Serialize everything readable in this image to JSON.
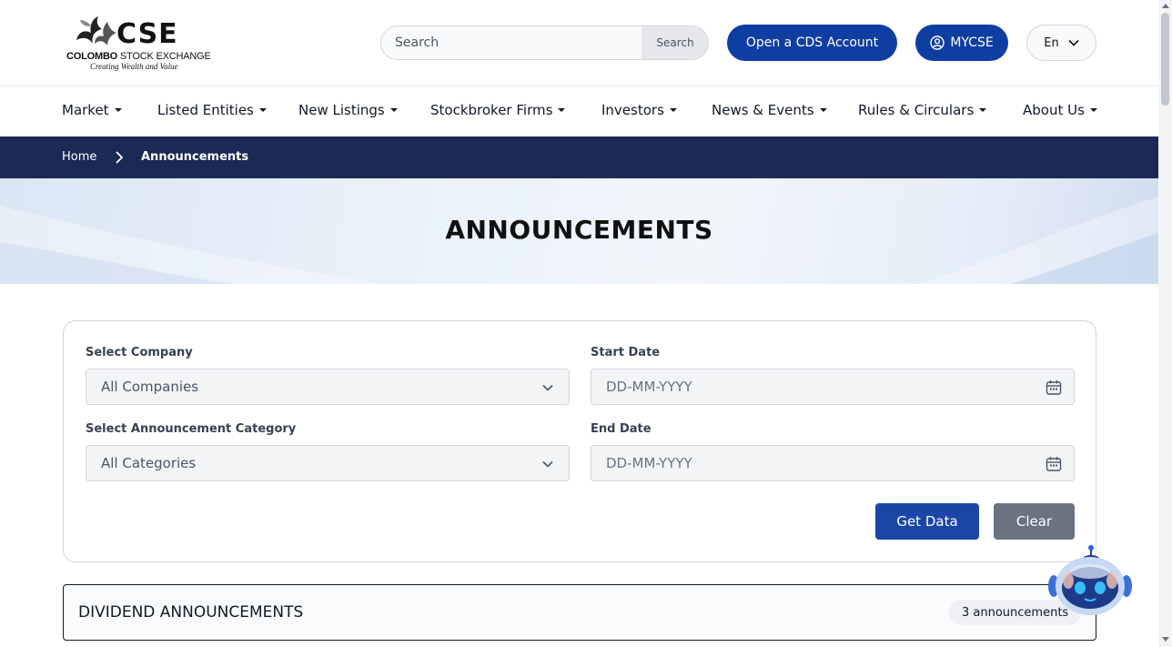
{
  "header": {
    "logo": {
      "letters": "CSE",
      "name_bold": "COLOMBO",
      "name_rest": " STOCK EXCHANGE",
      "tagline": "Creating Wealth and Value"
    },
    "search": {
      "placeholder": "Search",
      "button_label": "Search"
    },
    "cds_button": "Open a CDS Account",
    "mycse_button": "MYCSE",
    "language": "En"
  },
  "nav": {
    "items": [
      {
        "label": "Market"
      },
      {
        "label": "Listed Entities"
      },
      {
        "label": "New Listings"
      },
      {
        "label": "Stockbroker Firms"
      },
      {
        "label": "Investors"
      },
      {
        "label": "News & Events"
      },
      {
        "label": "Rules & Circulars"
      },
      {
        "label": "About Us"
      }
    ]
  },
  "breadcrumb": {
    "home": "Home",
    "current": "Announcements"
  },
  "banner": {
    "title": "ANNOUNCEMENTS"
  },
  "filters": {
    "company": {
      "label": "Select Company",
      "value": "All Companies"
    },
    "category": {
      "label": "Select Announcement Category",
      "value": "All Categories"
    },
    "start_date": {
      "label": "Start Date",
      "placeholder": "DD-MM-YYYY"
    },
    "end_date": {
      "label": "End Date",
      "placeholder": "DD-MM-YYYY"
    },
    "get_data_label": "Get Data",
    "clear_label": "Clear"
  },
  "dividend": {
    "title": "DIVIDEND ANNOUNCEMENTS",
    "count": "3 announcements"
  },
  "colors": {
    "primary": "#0f3ea3",
    "breadcrumb_bg": "#1b2a55",
    "clear_gray": "#6b7280"
  }
}
